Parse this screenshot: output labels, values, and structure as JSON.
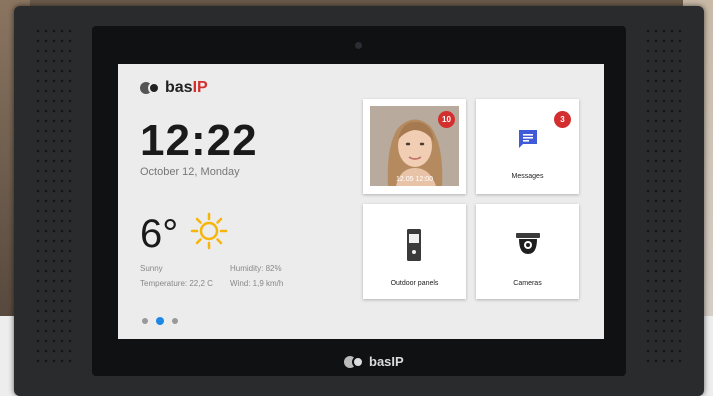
{
  "brand": {
    "name": "bas",
    "accent": "IP",
    "accent_color": "#d32f2f"
  },
  "clock": {
    "time": "12:22",
    "date": "October 12, Monday"
  },
  "weather": {
    "temperature": "6°",
    "condition": "Sunny",
    "humidity": "Humidity: 82%",
    "temp_detail": "Temperature: 22,2 C",
    "wind": "Wind: 1,9 km/h",
    "icon": "sun-icon"
  },
  "pager": {
    "count": 3,
    "active_index": 1,
    "active_color": "#1e88e5"
  },
  "tiles": {
    "visitor": {
      "badge": "10",
      "caption": "12.05 12:00"
    },
    "messages": {
      "label": "Messages",
      "badge": "3",
      "icon": "message-icon"
    },
    "outdoor": {
      "label": "Outdoor panels",
      "icon": "intercom-panel-icon"
    },
    "cameras": {
      "label": "Cameras",
      "icon": "dome-camera-icon"
    }
  }
}
